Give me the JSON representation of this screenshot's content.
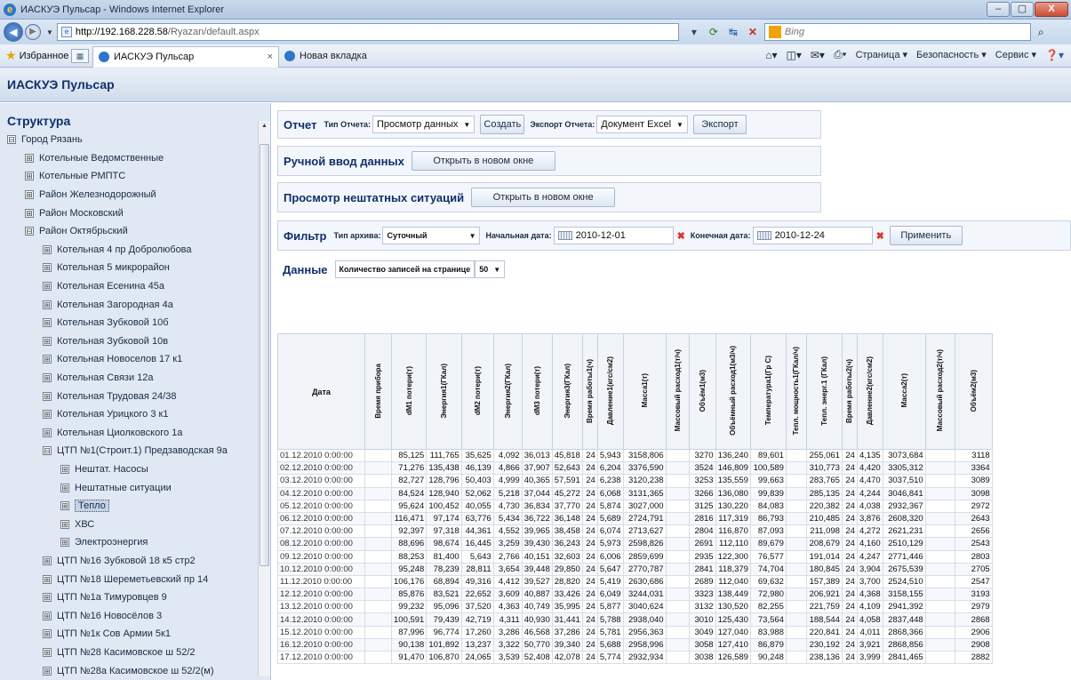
{
  "window": {
    "title": "ИАСКУЭ Пульсар - Windows Internet Explorer",
    "min": "–",
    "max": "▢",
    "close": "X"
  },
  "browser": {
    "url_host": "http://192.168.228.58",
    "url_path": "/Ryazan/default.aspx",
    "search_placeholder": "Bing",
    "favorites_label": "Избранное",
    "tabs": [
      {
        "label": "ИАСКУЭ Пульсар"
      },
      {
        "label": "Новая вкладка"
      }
    ],
    "commands": {
      "page": "Страница ▾",
      "security": "Безопасность ▾",
      "service": "Сервис ▾"
    }
  },
  "app": {
    "title": "ИАСКУЭ Пульсар"
  },
  "sidebar": {
    "title": "Структура",
    "items": [
      {
        "label": "Город Рязань",
        "sign": "⊟",
        "level": 1
      },
      {
        "label": "Котельные Ведомственные",
        "sign": "⊞",
        "level": 2
      },
      {
        "label": "Котельные РМПТС",
        "sign": "⊞",
        "level": 2
      },
      {
        "label": "Район Железнодорожный",
        "sign": "⊞",
        "level": 2
      },
      {
        "label": "Район Московский",
        "sign": "⊞",
        "level": 2
      },
      {
        "label": "Район Октябрьский",
        "sign": "⊟",
        "level": 2
      },
      {
        "label": "Котельная 4 пр Добролюбова",
        "sign": "⊞",
        "level": 3
      },
      {
        "label": "Котельная 5 микрорайон",
        "sign": "⊞",
        "level": 3
      },
      {
        "label": "Котельная Есенина 45а",
        "sign": "⊞",
        "level": 3
      },
      {
        "label": "Котельная Загородная 4а",
        "sign": "⊞",
        "level": 3
      },
      {
        "label": "Котельная Зубковой 10б",
        "sign": "⊞",
        "level": 3
      },
      {
        "label": "Котельная Зубковой 10в",
        "sign": "⊞",
        "level": 3
      },
      {
        "label": "Котельная Новоселов 17 к1",
        "sign": "⊞",
        "level": 3
      },
      {
        "label": "Котельная Связи 12а",
        "sign": "⊞",
        "level": 3
      },
      {
        "label": "Котельная Трудовая 24/38",
        "sign": "⊞",
        "level": 3
      },
      {
        "label": "Котельная Урицкого 3 к1",
        "sign": "⊞",
        "level": 3
      },
      {
        "label": "Котельная Циолковского 1а",
        "sign": "⊞",
        "level": 3
      },
      {
        "label": "ЦТП №1(Строит.1) Предзаводская 9а",
        "sign": "⊟",
        "level": 3
      },
      {
        "label": "Нештат. Насосы",
        "sign": "⊞",
        "level": 4
      },
      {
        "label": "Нештатные ситуации",
        "sign": "⊞",
        "level": 4
      },
      {
        "label": "Тепло",
        "sign": "⊞",
        "level": 4,
        "selected": true
      },
      {
        "label": "ХВС",
        "sign": "⊞",
        "level": 4
      },
      {
        "label": "Электроэнергия",
        "sign": "⊞",
        "level": 4
      },
      {
        "label": "ЦТП №16 Зубковой 18 к5 стр2",
        "sign": "⊞",
        "level": 3
      },
      {
        "label": "ЦТП №18 Шереметьевский пр 14",
        "sign": "⊞",
        "level": 3
      },
      {
        "label": "ЦТП №1а Тимуровцев 9",
        "sign": "⊞",
        "level": 3
      },
      {
        "label": "ЦТП №16 Новосёлов 3",
        "sign": "⊞",
        "level": 3
      },
      {
        "label": "ЦТП №1к Сов Армии 5к1",
        "sign": "⊞",
        "level": 3
      },
      {
        "label": "ЦТП №28 Касимовское ш 52/2",
        "sign": "⊞",
        "level": 3
      },
      {
        "label": "ЦТП №28а Касимовское ш 52/2(м)",
        "sign": "⊞",
        "level": 3
      }
    ]
  },
  "report": {
    "title": "Отчет",
    "type_label": "Тип Отчета:",
    "type_value": "Просмотр данных",
    "create": "Создать",
    "export_label": "Экспорт Отчета:",
    "export_value": "Документ Excel",
    "export_btn": "Экспорт"
  },
  "manual": {
    "title": "Ручной ввод данных",
    "btn": "Открыть в новом окне"
  },
  "emergency": {
    "title": "Просмотр нештатных ситуаций",
    "btn": "Открыть в новом окне"
  },
  "filter": {
    "title": "Фильтр",
    "archive_label": "Тип архива:",
    "archive_value": "Суточный",
    "start_label": "Начальная дата:",
    "start_value": "2010-12-01",
    "end_label": "Конечная дата:",
    "end_value": "2010-12-24",
    "apply": "Применить"
  },
  "data": {
    "title": "Данные",
    "per_page_label": "Количество записей на странице",
    "per_page_value": "50"
  },
  "table": {
    "columns": [
      "Дата",
      "Время прибора",
      "dM1 потери(т)",
      "Энергия1(ГКал)",
      "dM2 потери(т)",
      "Энергия2(ГКал)",
      "dM3 потери(т)",
      "Энергия3(ГКал)",
      "Время работы1(ч)",
      "Давление1(кгс/см2)",
      "Масса1(т)",
      "Массовый расход1(т/ч)",
      "Объём1(м3)",
      "Объёмный расход1(м3/ч)",
      "Температура1(Гр С)",
      "Тепл. мощность1(ГКал/ч)",
      "Тепл. энерг.1 (ГКал)",
      "Время работы2(ч)",
      "Давление2(кгс/см2)",
      "Масса2(т)",
      "Массовый расход2(т/ч)",
      "Объём2(м3)"
    ],
    "rows": [
      [
        "01.12.2010 0:00:00",
        "",
        "85,125",
        "111,765",
        "35,625",
        "4,092",
        "36,013",
        "45,818",
        "24",
        "5,943",
        "3158,806",
        "",
        "3270",
        "136,240",
        "89,601",
        "",
        "255,061",
        "24",
        "4,135",
        "3073,684",
        "",
        "3118"
      ],
      [
        "02.12.2010 0:00:00",
        "",
        "71,276",
        "135,438",
        "46,139",
        "4,866",
        "37,907",
        "52,643",
        "24",
        "6,204",
        "3376,590",
        "",
        "3524",
        "146,809",
        "100,589",
        "",
        "310,773",
        "24",
        "4,420",
        "3305,312",
        "",
        "3364"
      ],
      [
        "03.12.2010 0:00:00",
        "",
        "82,727",
        "128,796",
        "50,403",
        "4,999",
        "40,365",
        "57,591",
        "24",
        "6,238",
        "3120,238",
        "",
        "3253",
        "135,559",
        "99,663",
        "",
        "283,765",
        "24",
        "4,470",
        "3037,510",
        "",
        "3089"
      ],
      [
        "04.12.2010 0:00:00",
        "",
        "84,524",
        "128,940",
        "52,062",
        "5,218",
        "37,044",
        "45,272",
        "24",
        "6,068",
        "3131,365",
        "",
        "3266",
        "136,080",
        "99,839",
        "",
        "285,135",
        "24",
        "4,244",
        "3046,841",
        "",
        "3098"
      ],
      [
        "05.12.2010 0:00:00",
        "",
        "95,624",
        "100,452",
        "40,055",
        "4,730",
        "36,834",
        "37,770",
        "24",
        "5,874",
        "3027,000",
        "",
        "3125",
        "130,220",
        "84,083",
        "",
        "220,382",
        "24",
        "4,038",
        "2932,367",
        "",
        "2972"
      ],
      [
        "06.12.2010 0:00:00",
        "",
        "116,471",
        "97,174",
        "63,776",
        "5,434",
        "36,722",
        "36,148",
        "24",
        "5,689",
        "2724,791",
        "",
        "2816",
        "117,319",
        "86,793",
        "",
        "210,485",
        "24",
        "3,876",
        "2608,320",
        "",
        "2643"
      ],
      [
        "07.12.2010 0:00:00",
        "",
        "92,397",
        "97,318",
        "44,361",
        "4,552",
        "39,965",
        "38,458",
        "24",
        "6,074",
        "2713,627",
        "",
        "2804",
        "116,870",
        "87,093",
        "",
        "211,098",
        "24",
        "4,272",
        "2621,231",
        "",
        "2656"
      ],
      [
        "08.12.2010 0:00:00",
        "",
        "88,696",
        "98,674",
        "16,445",
        "3,259",
        "39,430",
        "36,243",
        "24",
        "5,973",
        "2598,826",
        "",
        "2691",
        "112,110",
        "89,679",
        "",
        "208,679",
        "24",
        "4,160",
        "2510,129",
        "",
        "2543"
      ],
      [
        "09.12.2010 0:00:00",
        "",
        "88,253",
        "81,400",
        "5,643",
        "2,766",
        "40,151",
        "32,603",
        "24",
        "6,006",
        "2859,699",
        "",
        "2935",
        "122,300",
        "76,577",
        "",
        "191,014",
        "24",
        "4,247",
        "2771,446",
        "",
        "2803"
      ],
      [
        "10.12.2010 0:00:00",
        "",
        "95,248",
        "78,239",
        "28,811",
        "3,654",
        "39,448",
        "29,850",
        "24",
        "5,647",
        "2770,787",
        "",
        "2841",
        "118,379",
        "74,704",
        "",
        "180,845",
        "24",
        "3,904",
        "2675,539",
        "",
        "2705"
      ],
      [
        "11.12.2010 0:00:00",
        "",
        "106,176",
        "68,894",
        "49,316",
        "4,412",
        "39,527",
        "28,820",
        "24",
        "5,419",
        "2630,686",
        "",
        "2689",
        "112,040",
        "69,632",
        "",
        "157,389",
        "24",
        "3,700",
        "2524,510",
        "",
        "2547"
      ],
      [
        "12.12.2010 0:00:00",
        "",
        "85,876",
        "83,521",
        "22,652",
        "3,609",
        "40,887",
        "33,426",
        "24",
        "6,049",
        "3244,031",
        "",
        "3323",
        "138,449",
        "72,980",
        "",
        "206,921",
        "24",
        "4,368",
        "3158,155",
        "",
        "3193"
      ],
      [
        "13.12.2010 0:00:00",
        "",
        "99,232",
        "95,096",
        "37,520",
        "4,363",
        "40,749",
        "35,995",
        "24",
        "5,877",
        "3040,624",
        "",
        "3132",
        "130,520",
        "82,255",
        "",
        "221,759",
        "24",
        "4,109",
        "2941,392",
        "",
        "2979"
      ],
      [
        "14.12.2010 0:00:00",
        "",
        "100,591",
        "79,439",
        "42,719",
        "4,311",
        "40,930",
        "31,441",
        "24",
        "5,788",
        "2938,040",
        "",
        "3010",
        "125,430",
        "73,564",
        "",
        "188,544",
        "24",
        "4,058",
        "2837,448",
        "",
        "2868"
      ],
      [
        "15.12.2010 0:00:00",
        "",
        "87,996",
        "96,774",
        "17,260",
        "3,286",
        "46,568",
        "37,286",
        "24",
        "5,781",
        "2956,363",
        "",
        "3049",
        "127,040",
        "83,988",
        "",
        "220,841",
        "24",
        "4,011",
        "2868,366",
        "",
        "2906"
      ],
      [
        "16.12.2010 0:00:00",
        "",
        "90,138",
        "101,892",
        "13,237",
        "3,322",
        "50,770",
        "39,340",
        "24",
        "5,688",
        "2958,996",
        "",
        "3058",
        "127,410",
        "86,879",
        "",
        "230,192",
        "24",
        "3,921",
        "2868,856",
        "",
        "2908"
      ],
      [
        "17.12.2010 0:00:00",
        "",
        "91,470",
        "106,870",
        "24,065",
        "3,539",
        "52,408",
        "42,078",
        "24",
        "5,774",
        "2932,934",
        "",
        "3038",
        "126,589",
        "90,248",
        "",
        "238,136",
        "24",
        "3,999",
        "2841,465",
        "",
        "2882"
      ]
    ]
  }
}
